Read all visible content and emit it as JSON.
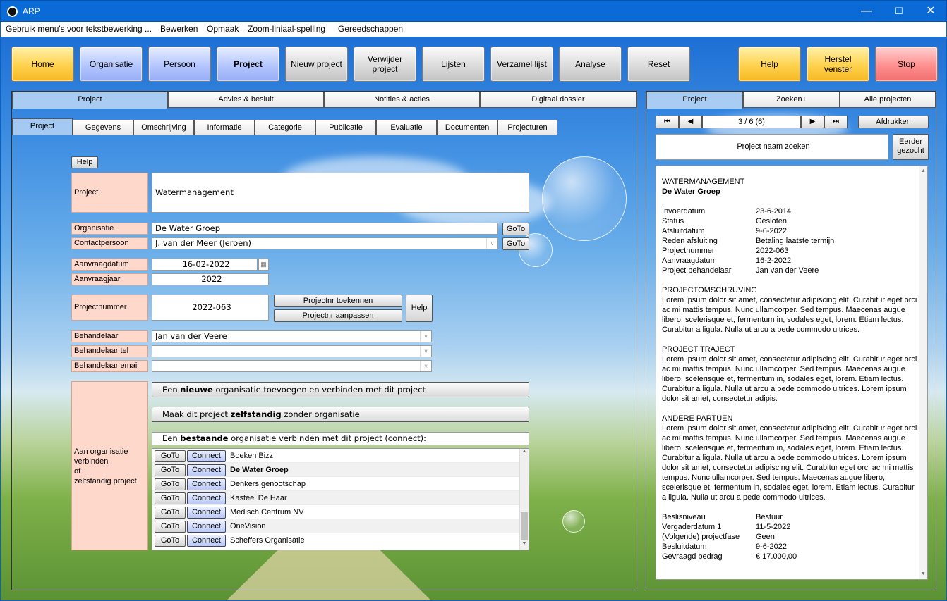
{
  "app": {
    "title": "ARP"
  },
  "menu": [
    "Gebruik menu's voor tekstbewerking ...",
    "Bewerken",
    "Opmaak",
    "Zoom-liniaal-spelling",
    "Gereedschappen"
  ],
  "toolbar": {
    "home": "Home",
    "organisatie": "Organisatie",
    "persoon": "Persoon",
    "project": "Project",
    "nieuw_project": "Nieuw project",
    "verwijder_project": "Verwijder project",
    "lijsten": "Lijsten",
    "verzamel_lijst": "Verzamel lijst",
    "analyse": "Analyse",
    "reset": "Reset",
    "help": "Help",
    "herstel_venster": "Herstel venster",
    "stop": "Stop"
  },
  "main_tabs": [
    "Project",
    "Advies & besluit",
    "Notities & acties",
    "Digitaal dossier"
  ],
  "sub_tabs": [
    "Project",
    "Gegevens",
    "Omschrijving",
    "Informatie",
    "Categorie",
    "Publicatie",
    "Evaluatie",
    "Documenten",
    "Projecturen"
  ],
  "form": {
    "help": "Help",
    "project_label": "Project",
    "project_value": "Watermanagement",
    "organisatie_label": "Organisatie",
    "organisatie_value": "De Water Groep",
    "contactpersoon_label": "Contactpersoon",
    "contactpersoon_value": "J. van der Meer (Jeroen)",
    "goto": "GoTo",
    "aanvraagdatum_label": "Aanvraagdatum",
    "aanvraagdatum_value": "16-02-2022",
    "aanvraagjaar_label": "Aanvraagjaar",
    "aanvraagjaar_value": "2022",
    "projectnummer_label": "Projectnummer",
    "projectnummer_value": "2022-063",
    "projectnr_toekennen": "Projectnr toekennen",
    "projectnr_aanpassen": "Projectnr aanpassen",
    "behandelaar_label": "Behandelaar",
    "behandelaar_value": "Jan van der Veere",
    "behandelaar_tel_label": "Behandelaar tel",
    "behandelaar_tel_value": "",
    "behandelaar_email_label": "Behandelaar email",
    "behandelaar_email_value": "",
    "aan_org_label": [
      "Aan organisatie",
      "verbinden",
      "of",
      "zelfstandig project"
    ],
    "btn_nieuwe": {
      "pre": "Een ",
      "bold": "nieuwe",
      "post": " organisatie toevoegen en verbinden met dit project"
    },
    "btn_zelfstandig": {
      "pre": "Maak dit project ",
      "bold": "zelfstandig",
      "post": " zonder organisatie"
    },
    "btn_bestaande": {
      "pre": "Een ",
      "bold": "bestaande",
      "post": " organisatie verbinden met dit project (connect):"
    },
    "connect": "Connect",
    "organisations": [
      "Boeken Bizz",
      "De Water Groep",
      "Denkers genootschap",
      "Kasteel De Haar",
      "Medisch Centrum NV",
      "OneVision",
      "Scheffers Organisatie"
    ]
  },
  "right": {
    "tabs": [
      "Project",
      "Zoeken+",
      "Alle projecten"
    ],
    "nav_first": "⏮",
    "nav_prev": "◀",
    "record": "3 / 6 (6)",
    "nav_next": "▶",
    "nav_last": "⏭",
    "afdrukken": "Afdrukken",
    "search": "Project naam zoeken",
    "eerder": "Eerder gezocht",
    "title1": "WATERMANAGEMENT",
    "title2": "De Water Groep",
    "fields": [
      [
        "Invoerdatum",
        "23-6-2014"
      ],
      [
        "Status",
        "Gesloten"
      ],
      [
        "Afsluitdatum",
        "9-6-2022"
      ],
      [
        "Reden afsluiting",
        "Betaling laatste termijn"
      ],
      [
        "Projectnummer",
        "2022-063"
      ],
      [
        "Aanvraagdatum",
        "16-2-2022"
      ],
      [
        "Project behandelaar",
        "Jan van der Veere"
      ]
    ],
    "sections": [
      {
        "h": "PROJECTOMSCHRUVING",
        "t": "Lorem ipsum dolor sit amet, consectetur adipiscing elit. Curabitur eget orci ac mi mattis tempus. Nunc ullamcorper. Sed tempus. Maecenas augue libero, scelerisque et, fermentum in, sodales eget, lorem. Etiam lectus. Curabitur a ligula. Nulla ut arcu a pede commodo ultrices."
      },
      {
        "h": "PROJECT TRAJECT",
        "t": "Lorem ipsum dolor sit amet, consectetur adipiscing elit. Curabitur eget orci ac mi mattis tempus. Nunc ullamcorper. Sed tempus. Maecenas augue libero, scelerisque et, fermentum in, sodales eget, lorem. Etiam lectus. Curabitur a ligula. Nulla ut arcu a pede commodo ultrices. Lorem ipsum dolor sit amet, consectetur adipis."
      },
      {
        "h": "ANDERE PARTUEN",
        "t": "Lorem ipsum dolor sit amet, consectetur adipiscing elit. Curabitur eget orci ac mi mattis tempus. Nunc ullamcorper. Sed tempus. Maecenas augue libero, scelerisque et, fermentum in, sodales eget, lorem. Etiam lectus. Curabitur a ligula. Nulla ut arcu a pede commodo ultrices. Lorem ipsum dolor sit amet, consectetur adipiscing elit. Curabitur eget orci ac mi mattis tempus. Nunc ullamcorper. Sed tempus. Maecenas augue libero, scelerisque et, fermentum in, sodales eget, lorem. Etiam lectus. Curabitur a ligula. Nulla ut arcu a pede commodo ultrices."
      }
    ],
    "fields2": [
      [
        "Beslisniveau",
        "Bestuur"
      ],
      [
        "Vergaderdatum 1",
        "11-5-2022"
      ],
      [
        "(Volgende) projectfase",
        "Geen"
      ],
      [
        "Besluitdatum",
        "9-6-2022"
      ],
      [
        "Gevraagd bedrag",
        "€ 17.000,00"
      ]
    ]
  }
}
